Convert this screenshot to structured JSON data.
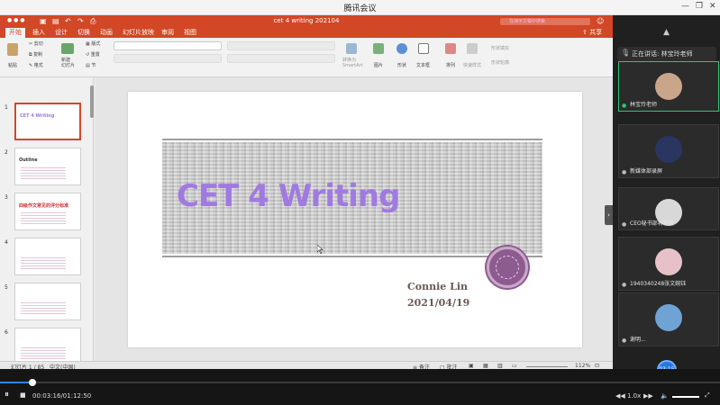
{
  "window": {
    "title": "腾讯会议"
  },
  "ppt": {
    "doc_title": "cet 4 writing 202104",
    "search_placeholder": "在演示文稿中搜索",
    "share_label": "共享",
    "tabs": [
      "开始",
      "插入",
      "设计",
      "切换",
      "动画",
      "幻灯片放映",
      "审阅",
      "视图"
    ],
    "active_tab": "开始",
    "ribbon": {
      "paste": "粘贴",
      "cut": "剪切",
      "copy": "复制",
      "format": "格式",
      "new_slide": "新建\n幻灯片",
      "layout": "版式",
      "reset": "重置",
      "section": "节",
      "convert_smartart": "转换为\nSmartArt",
      "picture": "图片",
      "shape": "形状",
      "textbox": "文本框",
      "arrange": "排列",
      "quick_styles": "快速样式",
      "shape_fill": "形状填充",
      "shape_outline": "形状轮廓"
    },
    "thumbnails": [
      {
        "num": "1",
        "title": "CET 4 Writing",
        "selected": true
      },
      {
        "num": "2",
        "title": "Outline",
        "selected": false
      },
      {
        "num": "3",
        "title": "四级作文常见的评分标准",
        "selected": false
      },
      {
        "num": "4",
        "title": "",
        "selected": false
      },
      {
        "num": "5",
        "title": "",
        "selected": false
      },
      {
        "num": "6",
        "title": "",
        "selected": false
      }
    ],
    "slide": {
      "title": "CET 4 Writing",
      "author": "Connie Lin",
      "date": "2021/04/19"
    },
    "status": {
      "slide_counter": "幻灯片 1 / 85",
      "language": "中文(中国)",
      "notes": "备注",
      "comments": "批注",
      "zoom": "112%"
    }
  },
  "meeting": {
    "speaking_label": "正在讲话: 林宝玲老师",
    "participants": [
      {
        "name": "林宝玲老师",
        "speaking": true,
        "avatar_color": "#c9a58a"
      },
      {
        "name": "新媒体部录屏",
        "speaking": false,
        "avatar_color": "#2a3660"
      },
      {
        "name": "CEO秘书部蒋耿慧",
        "speaking": false,
        "avatar_color": "#d8d8d8"
      },
      {
        "name": "1940340248张文婉钰",
        "speaking": false,
        "avatar_color": "#e6c2c8"
      },
      {
        "name": "谢明...",
        "speaking": false,
        "avatar_color": "#6fa3d6"
      }
    ],
    "timer": "03:15"
  },
  "player": {
    "current_time": "00:03:16",
    "total_time": "01:12:50",
    "time_display": "00:03:16/01:12:50",
    "speed": "1.0x",
    "progress": 0.045
  },
  "colors": {
    "ppt_accent": "#d24726",
    "slide_title": "#a07ae0",
    "author_text": "#6b5852",
    "speaking_border": "#2fc47d",
    "player_progress": "#2a86ff"
  }
}
